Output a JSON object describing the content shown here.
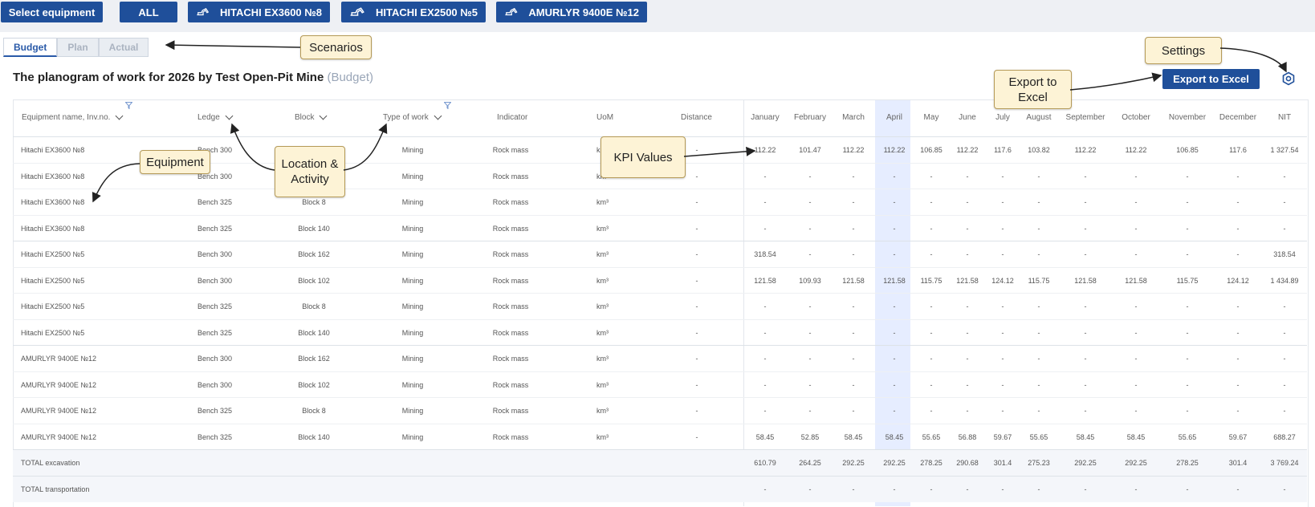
{
  "equipment_bar": {
    "select_label": "Select equipment",
    "all_label": "ALL",
    "items": [
      "HITACHI EX3600 №8",
      "HITACHI EX2500 №5",
      "AMURLYR 9400E №12"
    ]
  },
  "tabs": [
    "Budget",
    "Plan",
    "Actual"
  ],
  "title": {
    "main": "The planogram of work for 2026 by Test Open-Pit Mine",
    "scenario": "(Budget)"
  },
  "export_label": "Export to Excel",
  "columns": {
    "equipment": "Equipment name, Inv.no.",
    "ledge": "Ledge",
    "block": "Block",
    "type": "Type of work",
    "indicator": "Indicator",
    "uom": "UoM",
    "distance": "Distance",
    "months": [
      "January",
      "February",
      "March",
      "April",
      "May",
      "June",
      "July",
      "August",
      "September",
      "October",
      "November",
      "December",
      "NIT"
    ]
  },
  "rows": [
    {
      "equipment": "Hitachi EX3600 №8",
      "ledge": "Bench 300",
      "block": "Block 162",
      "type": "Mining",
      "indicator": "Rock mass",
      "uom": "km³",
      "distance": "-",
      "values": [
        "112.22",
        "101.47",
        "112.22",
        "112.22",
        "106.85",
        "112.22",
        "117.6",
        "103.82",
        "112.22",
        "112.22",
        "106.85",
        "117.6",
        "1 327.54"
      ]
    },
    {
      "equipment": "Hitachi EX3600 №8",
      "ledge": "Bench 300",
      "block": "Block 102",
      "type": "Mining",
      "indicator": "Rock mass",
      "uom": "km³",
      "distance": "-",
      "values": [
        "-",
        "-",
        "-",
        "-",
        "-",
        "-",
        "-",
        "-",
        "-",
        "-",
        "-",
        "-",
        "-"
      ]
    },
    {
      "equipment": "Hitachi EX3600 №8",
      "ledge": "Bench 325",
      "block": "Block 8",
      "type": "Mining",
      "indicator": "Rock mass",
      "uom": "km³",
      "distance": "-",
      "values": [
        "-",
        "-",
        "-",
        "-",
        "-",
        "-",
        "-",
        "-",
        "-",
        "-",
        "-",
        "-",
        "-"
      ]
    },
    {
      "equipment": "Hitachi EX3600 №8",
      "ledge": "Bench 325",
      "block": "Block 140",
      "type": "Mining",
      "indicator": "Rock mass",
      "uom": "km³",
      "distance": "-",
      "values": [
        "-",
        "-",
        "-",
        "-",
        "-",
        "-",
        "-",
        "-",
        "-",
        "-",
        "-",
        "-",
        "-"
      ]
    },
    {
      "equipment": "Hitachi EX2500 №5",
      "ledge": "Bench 300",
      "block": "Block 162",
      "type": "Mining",
      "indicator": "Rock mass",
      "uom": "km³",
      "distance": "-",
      "values": [
        "318.54",
        "-",
        "-",
        "-",
        "-",
        "-",
        "-",
        "-",
        "-",
        "-",
        "-",
        "-",
        "318.54"
      ]
    },
    {
      "equipment": "Hitachi EX2500 №5",
      "ledge": "Bench 300",
      "block": "Block 102",
      "type": "Mining",
      "indicator": "Rock mass",
      "uom": "km³",
      "distance": "-",
      "values": [
        "121.58",
        "109.93",
        "121.58",
        "121.58",
        "115.75",
        "121.58",
        "124.12",
        "115.75",
        "121.58",
        "121.58",
        "115.75",
        "124.12",
        "1 434.89"
      ]
    },
    {
      "equipment": "Hitachi EX2500 №5",
      "ledge": "Bench 325",
      "block": "Block 8",
      "type": "Mining",
      "indicator": "Rock mass",
      "uom": "km³",
      "distance": "-",
      "values": [
        "-",
        "-",
        "-",
        "-",
        "-",
        "-",
        "-",
        "-",
        "-",
        "-",
        "-",
        "-",
        "-"
      ]
    },
    {
      "equipment": "Hitachi EX2500 №5",
      "ledge": "Bench 325",
      "block": "Block 140",
      "type": "Mining",
      "indicator": "Rock mass",
      "uom": "km³",
      "distance": "-",
      "values": [
        "-",
        "-",
        "-",
        "-",
        "-",
        "-",
        "-",
        "-",
        "-",
        "-",
        "-",
        "-",
        "-"
      ]
    },
    {
      "equipment": "AMURLYR 9400E №12",
      "ledge": "Bench 300",
      "block": "Block 162",
      "type": "Mining",
      "indicator": "Rock mass",
      "uom": "km³",
      "distance": "-",
      "values": [
        "-",
        "-",
        "-",
        "-",
        "-",
        "-",
        "-",
        "-",
        "-",
        "-",
        "-",
        "-",
        "-"
      ]
    },
    {
      "equipment": "AMURLYR 9400E №12",
      "ledge": "Bench 300",
      "block": "Block 102",
      "type": "Mining",
      "indicator": "Rock mass",
      "uom": "km³",
      "distance": "-",
      "values": [
        "-",
        "-",
        "-",
        "-",
        "-",
        "-",
        "-",
        "-",
        "-",
        "-",
        "-",
        "-",
        "-"
      ]
    },
    {
      "equipment": "AMURLYR 9400E №12",
      "ledge": "Bench 325",
      "block": "Block 8",
      "type": "Mining",
      "indicator": "Rock mass",
      "uom": "km³",
      "distance": "-",
      "values": [
        "-",
        "-",
        "-",
        "-",
        "-",
        "-",
        "-",
        "-",
        "-",
        "-",
        "-",
        "-",
        "-"
      ]
    },
    {
      "equipment": "AMURLYR 9400E №12",
      "ledge": "Bench 325",
      "block": "Block 140",
      "type": "Mining",
      "indicator": "Rock mass",
      "uom": "km³",
      "distance": "-",
      "values": [
        "58.45",
        "52.85",
        "58.45",
        "58.45",
        "55.65",
        "56.88",
        "59.67",
        "55.65",
        "58.45",
        "58.45",
        "55.65",
        "59.67",
        "688.27"
      ]
    }
  ],
  "totals": [
    {
      "label": "TOTAL excavation",
      "values": [
        "610.79",
        "264.25",
        "292.25",
        "292.25",
        "278.25",
        "290.68",
        "301.4",
        "275.23",
        "292.25",
        "292.25",
        "278.25",
        "301.4",
        "3 769.24"
      ]
    },
    {
      "label": "TOTAL transportation",
      "values": [
        "-",
        "-",
        "-",
        "-",
        "-",
        "-",
        "-",
        "-",
        "-",
        "-",
        "-",
        "-",
        "-"
      ]
    }
  ],
  "callouts": {
    "scenarios": "Scenarios",
    "settings": "Settings",
    "export": "Export to Excel",
    "equipment": "Equipment",
    "location": "Location & Activity",
    "kpi": "KPI Values"
  },
  "colors": {
    "accent": "#1f4f9a",
    "highlight_column": "#e6edff",
    "callout_bg": "#fdf3d6"
  }
}
